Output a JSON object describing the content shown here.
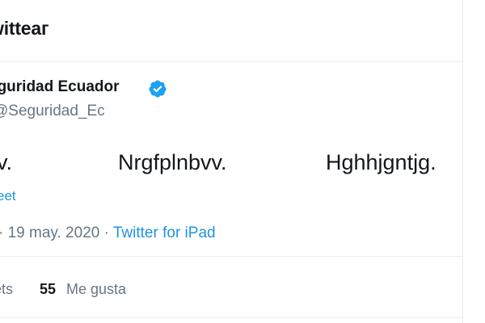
{
  "header": {
    "title": "witteaг"
  },
  "tweet": {
    "author_name": "eguridad Ecuador",
    "handle": "Seguridad_Ec",
    "verified_icon": "verified-badge-icon",
    "text_parts": [
      "v.",
      "Nrgfplnbvv.",
      "Hghhjgntjg."
    ],
    "translate_link": "eet",
    "date": "· 19 may. 2020 ·",
    "source": "Twitter for iPad",
    "retweets_label": "ets",
    "likes_count": "55",
    "likes_label": "Me gusta"
  },
  "colors": {
    "link": "#1b95e0",
    "secondary_text": "#657786",
    "primary_text": "#14171a",
    "border": "#e6ecf0",
    "verified": "#1da1f2"
  }
}
